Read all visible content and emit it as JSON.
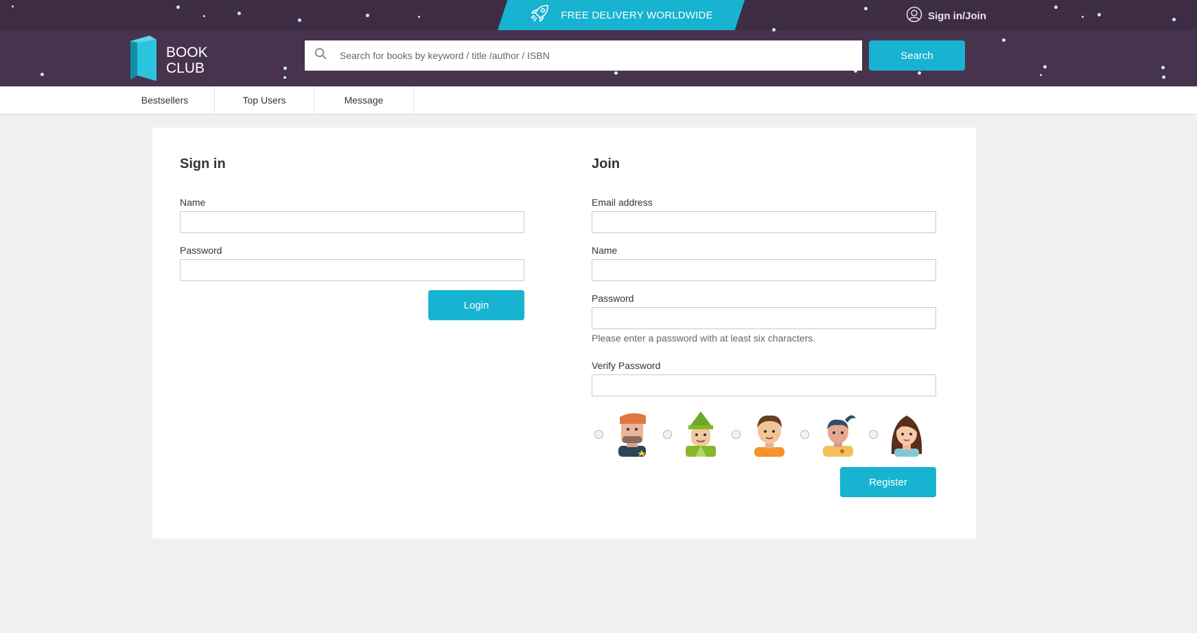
{
  "banner": {
    "text": "FREE DELIVERY WORLDWIDE",
    "icon": "rocket-icon"
  },
  "account": {
    "label": "Sign in/Join",
    "icon": "user-icon"
  },
  "logo": {
    "line1": "BOOK",
    "line2": "CLUB",
    "icon": "book-icon"
  },
  "search": {
    "placeholder": "Search for books by keyword / title /author / ISBN",
    "value": "",
    "button": "Search",
    "icon": "search-icon"
  },
  "nav": {
    "items": [
      "Bestsellers",
      "Top Users",
      "Message"
    ]
  },
  "signin": {
    "title": "Sign in",
    "name_label": "Name",
    "name_value": "",
    "password_label": "Password",
    "password_value": "",
    "button": "Login"
  },
  "join": {
    "title": "Join",
    "email_label": "Email address",
    "email_value": "",
    "name_label": "Name",
    "name_value": "",
    "password_label": "Password",
    "password_value": "",
    "password_hint": "Please enter a password with at least six characters.",
    "verify_label": "Verify Password",
    "verify_value": "",
    "avatars": [
      "avatar-beret-man",
      "avatar-elf",
      "avatar-boy",
      "avatar-ponytail-woman",
      "avatar-girl"
    ],
    "button": "Register"
  },
  "colors": {
    "header_bg": "#48334e",
    "topbar_bg": "#3e2c45",
    "accent": "#17b3d0",
    "page_bg": "#f0f0f0"
  }
}
